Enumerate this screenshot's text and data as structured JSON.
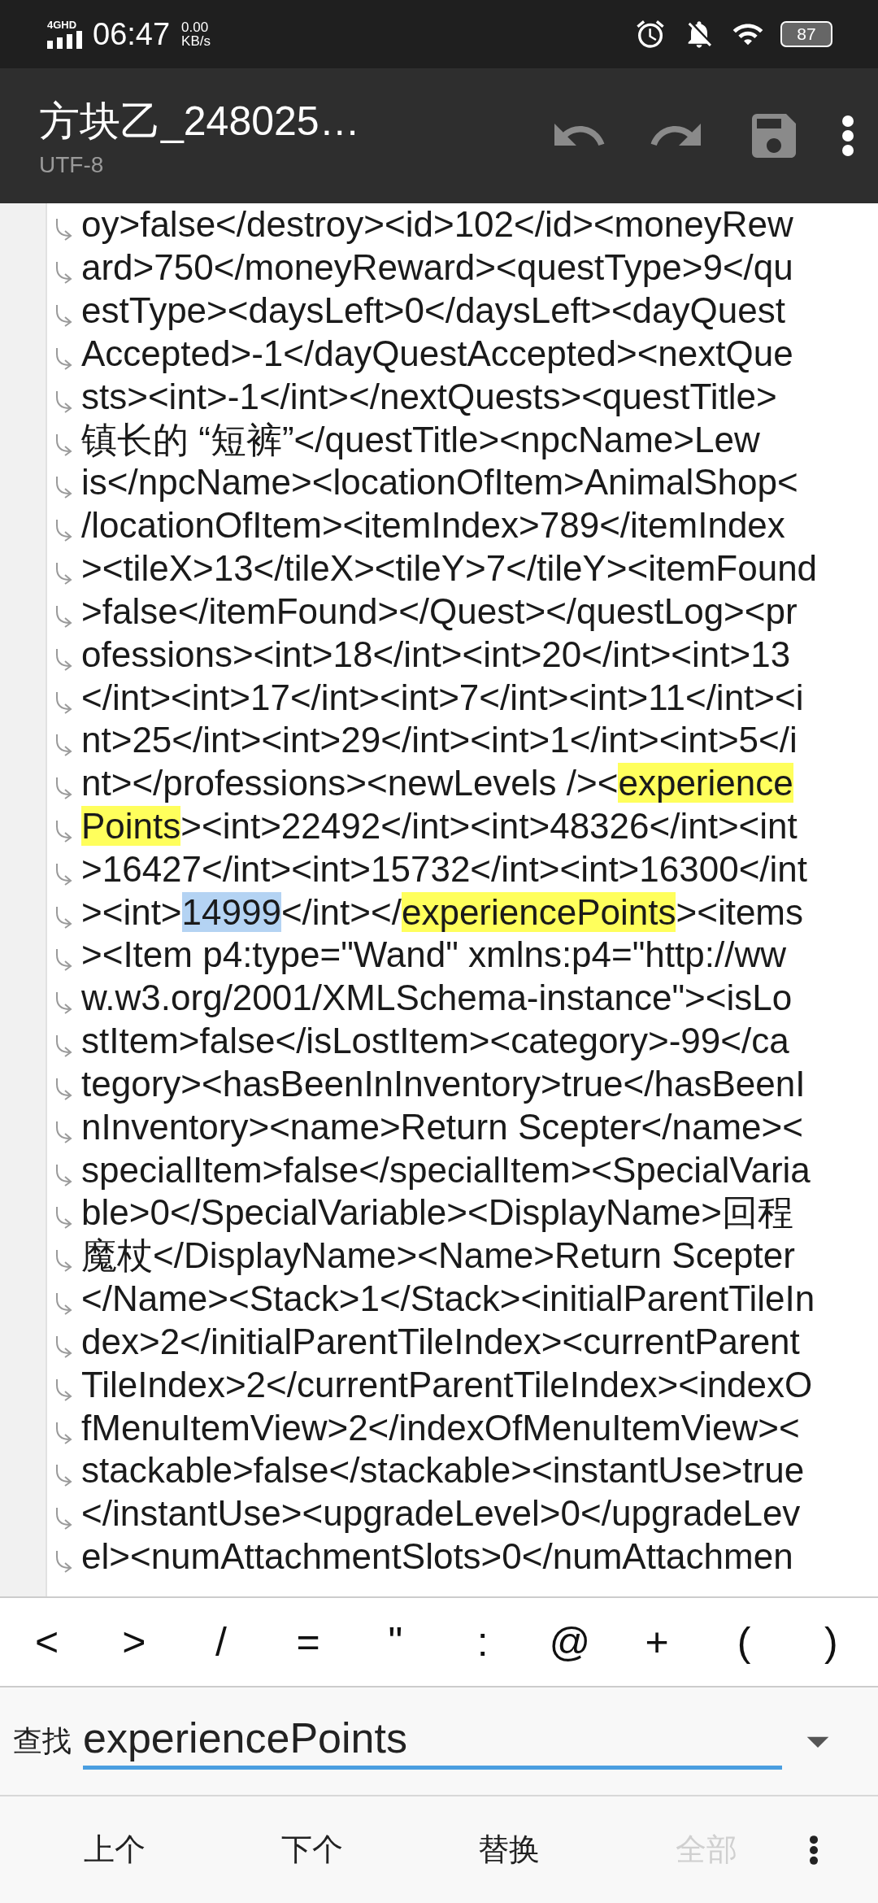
{
  "status_bar": {
    "network": "4GHD",
    "time": "06:47",
    "speed_value": "0.00",
    "speed_unit": "KB/s",
    "battery": "87"
  },
  "toolbar": {
    "title": "方块乙_248025…",
    "encoding": "UTF-8"
  },
  "editor": {
    "lines": [
      {
        "text": "oy>false</destroy><id>102</id><moneyRew"
      },
      {
        "text": "ard>750</moneyReward><questType>9</qu"
      },
      {
        "text": "estType><daysLeft>0</daysLeft><dayQuest"
      },
      {
        "text": "Accepted>-1</dayQuestAccepted><nextQue"
      },
      {
        "text": "sts><int>-1</int></nextQuests><questTitle>"
      },
      {
        "text": "镇长的 “短裤”</questTitle><npcName>Lew"
      },
      {
        "text": "is</npcName><locationOfItem>AnimalShop<"
      },
      {
        "text": "/locationOfItem><itemIndex>789</itemIndex"
      },
      {
        "text": "><tileX>13</tileX><tileY>7</tileY><itemFound"
      },
      {
        "text": ">false</itemFound></Quest></questLog><pr"
      },
      {
        "text": "ofessions><int>18</int><int>20</int><int>13"
      },
      {
        "text": "</int><int>17</int><int>7</int><int>11</int><i"
      },
      {
        "text": "nt>25</int><int>29</int><int>1</int><int>5</i"
      },
      {
        "segments": [
          {
            "text": "nt></professions><newLevels /><",
            "highlighted": false,
            "selected": false
          },
          {
            "text": "experience",
            "highlighted": true,
            "selected": false
          }
        ]
      },
      {
        "segments": [
          {
            "text": "Points",
            "highlighted": true,
            "selected": false
          },
          {
            "text": "><int>22492</int><int>48326</int><int",
            "highlighted": false,
            "selected": false
          }
        ]
      },
      {
        "text": ">16427</int><int>15732</int><int>16300</int"
      },
      {
        "segments": [
          {
            "text": "><int>",
            "highlighted": false,
            "selected": false
          },
          {
            "text": "14999",
            "highlighted": false,
            "selected": true
          },
          {
            "text": "</int></",
            "highlighted": false,
            "selected": false
          },
          {
            "text": "experiencePoints",
            "highlighted": true,
            "selected": false
          },
          {
            "text": "><items",
            "highlighted": false,
            "selected": false
          }
        ]
      },
      {
        "text": "><Item p4:type=\"Wand\" xmlns:p4=\"http://ww"
      },
      {
        "text": "w.w3.org/2001/XMLSchema-instance\"><isLo"
      },
      {
        "text": "stItem>false</isLostItem><category>-99</ca"
      },
      {
        "text": "tegory><hasBeenInInventory>true</hasBeenI"
      },
      {
        "text": "nInventory><name>Return Scepter</name><"
      },
      {
        "text": "specialItem>false</specialItem><SpecialVaria"
      },
      {
        "text": "ble>0</SpecialVariable><DisplayName>回程"
      },
      {
        "text": "魔杖</DisplayName><Name>Return Scepter"
      },
      {
        "text": "</Name><Stack>1</Stack><initialParentTileIn"
      },
      {
        "text": "dex>2</initialParentTileIndex><currentParent"
      },
      {
        "text": "TileIndex>2</currentParentTileIndex><indexO"
      },
      {
        "text": "fMenuItemView>2</indexOfMenuItemView><"
      },
      {
        "text": "stackable>false</stackable><instantUse>true"
      },
      {
        "text": "</instantUse><upgradeLevel>0</upgradeLev"
      },
      {
        "text": "el><numAttachmentSlots>0</numAttachmen"
      }
    ]
  },
  "symbol_keys": [
    "<",
    ">",
    "/",
    "=",
    "\"",
    ":",
    "@",
    "+",
    "(",
    ")"
  ],
  "find": {
    "label": "查找",
    "value": "experiencePoints"
  },
  "actions": [
    {
      "label": "上个",
      "disabled": false
    },
    {
      "label": "下个",
      "disabled": false
    },
    {
      "label": "替换",
      "disabled": false
    },
    {
      "label": "全部",
      "disabled": true
    }
  ]
}
